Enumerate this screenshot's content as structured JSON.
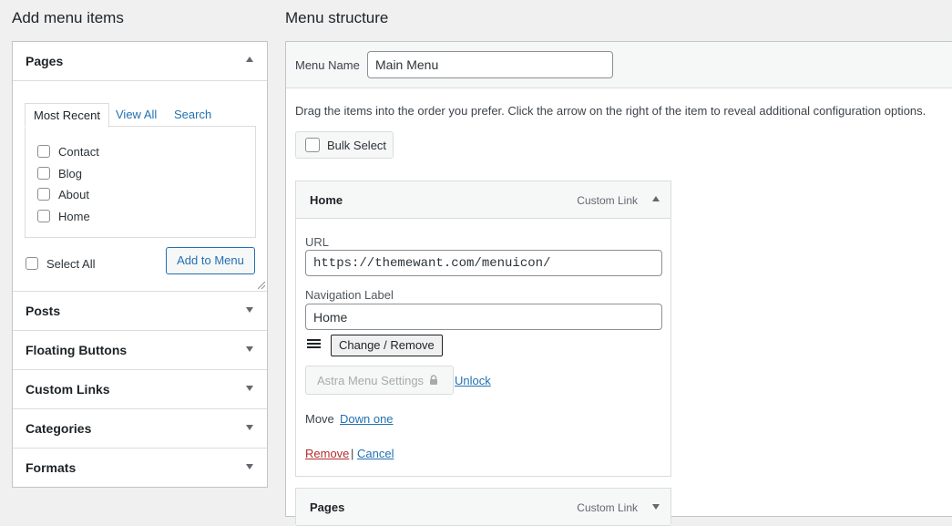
{
  "left": {
    "heading": "Add menu items",
    "pages": {
      "title": "Pages",
      "tabs": [
        "Most Recent",
        "View All",
        "Search"
      ],
      "items": [
        "Contact",
        "Blog",
        "About",
        "Home"
      ],
      "select_all": "Select All",
      "add_button": "Add to Menu"
    },
    "sections": [
      "Posts",
      "Floating Buttons",
      "Custom Links",
      "Categories",
      "Formats"
    ]
  },
  "right": {
    "heading": "Menu structure",
    "menu_name_label": "Menu Name",
    "menu_name_value": "Main Menu",
    "instructions": "Drag the items into the order you prefer. Click the arrow on the right of the item to reveal additional configuration options.",
    "bulk_select": "Bulk Select",
    "item": {
      "title": "Home",
      "type": "Custom Link",
      "url_label": "URL",
      "url_value": "https://themewant.com/menuicon/",
      "nav_label": "Navigation Label",
      "nav_value": "Home",
      "change_remove": "Change / Remove",
      "astra_settings": "Astra Menu Settings",
      "unlock": "Unlock",
      "move_label": "Move",
      "down_one": "Down one",
      "remove": "Remove",
      "separator": "|",
      "cancel": "Cancel"
    },
    "next_item": {
      "title": "Pages",
      "type": "Custom Link"
    }
  },
  "colors": {
    "link": "#2271b1",
    "remove": "#b32d2e",
    "border": "#c3c4c7",
    "background": "#f0f0f1"
  },
  "icons": {
    "lock": "lock-icon",
    "drag": "hamburger-icon"
  }
}
